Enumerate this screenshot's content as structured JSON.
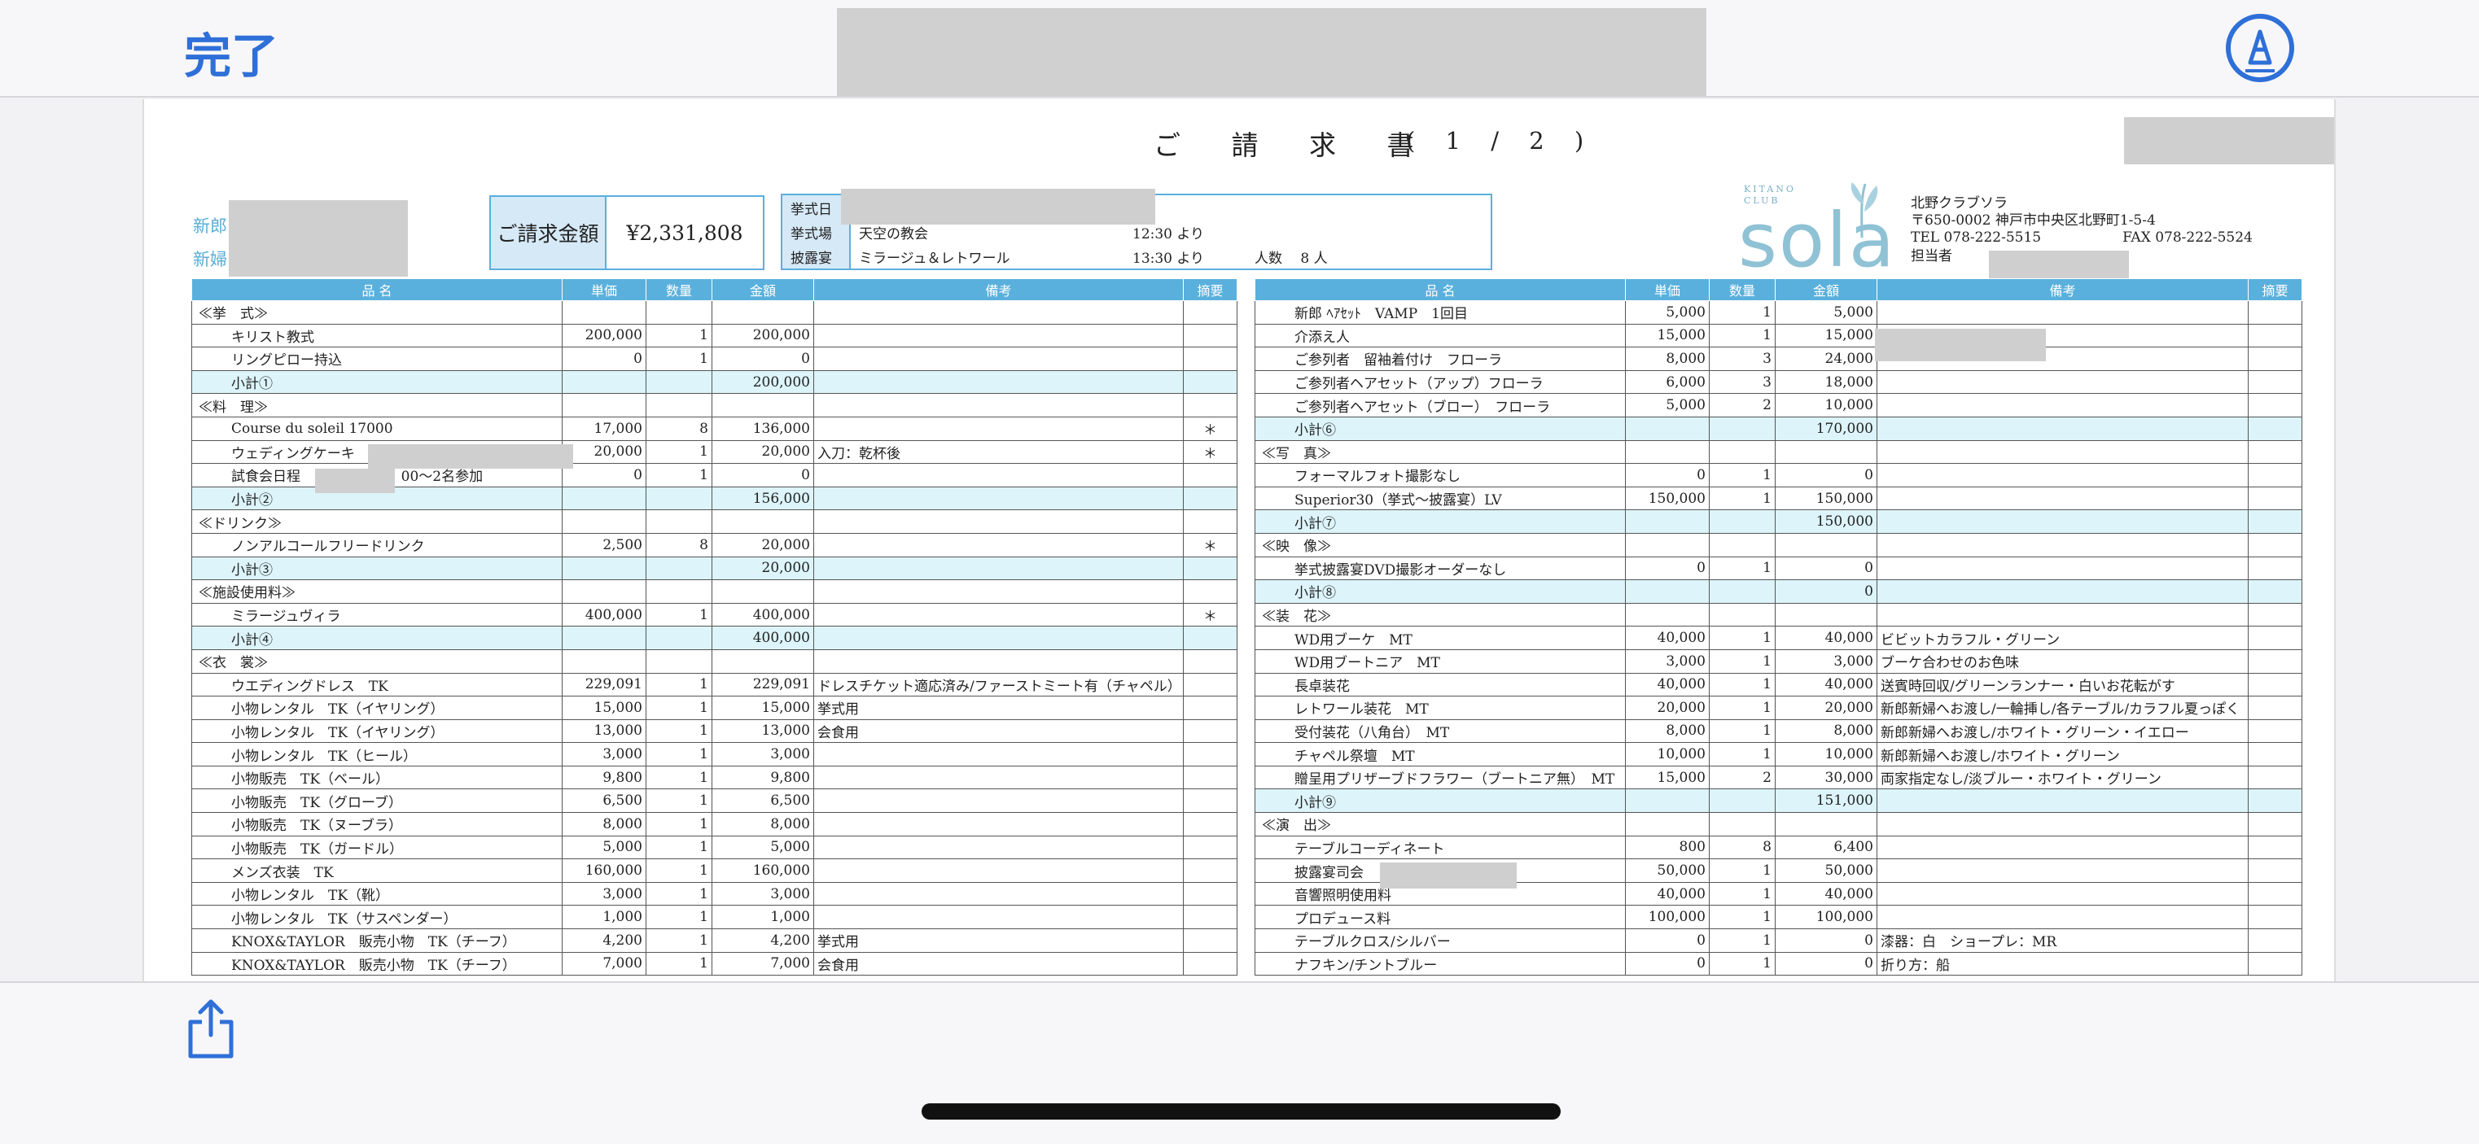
{
  "topbar": {
    "done_label": "完了",
    "markup_icon": "markup-pen-icon"
  },
  "document": {
    "title": "ご 請 求 書",
    "page": "( 1 / 2 )",
    "couple": {
      "groom_label": "新郎",
      "bride_label": "新婦"
    },
    "invoice": {
      "label": "ご請求金額",
      "amount": "¥2,331,808"
    },
    "ceremony": {
      "rows": [
        {
          "label": "挙式日",
          "value": "",
          "time": "",
          "extra": ""
        },
        {
          "label": "挙式場",
          "value": "天空の教会",
          "time": "12:30 より",
          "extra": ""
        },
        {
          "label": "披露宴",
          "value": "ミラージュ＆レトワール",
          "time": "13:30 より",
          "extra": "人数　 8 人"
        }
      ]
    },
    "logo": {
      "sub": "KITANO\nCLUB",
      "text": "sola"
    },
    "company": {
      "name": "北野クラブソラ",
      "address": "〒650-0002 神戸市中央区北野町1-5-4",
      "tel": "TEL 078-222-5515",
      "fax": "FAX 078-222-5524",
      "staff_label": "担当者"
    },
    "headers": [
      "品 名",
      "単価",
      "数量",
      "金額",
      "備考",
      "摘要"
    ],
    "left_rows": [
      {
        "t": "cat",
        "name": "≪挙　式≫"
      },
      {
        "t": "item",
        "name": "キリスト教式",
        "price": "200,000",
        "qty": "1",
        "amount": "200,000",
        "note": "",
        "mark": ""
      },
      {
        "t": "item",
        "name": "リングピロー持込",
        "price": "0",
        "qty": "1",
        "amount": "0",
        "note": "",
        "mark": ""
      },
      {
        "t": "sub",
        "name": "小計①",
        "amount": "200,000"
      },
      {
        "t": "cat",
        "name": "≪料　理≫"
      },
      {
        "t": "item",
        "name": "Course du soleil 17000",
        "price": "17,000",
        "qty": "8",
        "amount": "136,000",
        "note": "",
        "mark": "＊"
      },
      {
        "t": "item",
        "name": "ウェディングケーキ",
        "price": "20,000",
        "qty": "1",
        "amount": "20,000",
        "note": "入刀：乾杯後",
        "mark": "＊"
      },
      {
        "t": "item",
        "name": "試食会日程　　　　　18：00〜2名参加",
        "price": "0",
        "qty": "1",
        "amount": "0",
        "note": "",
        "mark": ""
      },
      {
        "t": "sub",
        "name": "小計②",
        "amount": "156,000"
      },
      {
        "t": "cat",
        "name": "≪ドリンク≫"
      },
      {
        "t": "item",
        "name": "ノンアルコールフリードリンク",
        "price": "2,500",
        "qty": "8",
        "amount": "20,000",
        "note": "",
        "mark": "＊"
      },
      {
        "t": "sub",
        "name": "小計③",
        "amount": "20,000"
      },
      {
        "t": "cat",
        "name": "≪施設使用料≫"
      },
      {
        "t": "item",
        "name": "ミラージュヴィラ",
        "price": "400,000",
        "qty": "1",
        "amount": "400,000",
        "note": "",
        "mark": "＊"
      },
      {
        "t": "sub",
        "name": "小計④",
        "amount": "400,000"
      },
      {
        "t": "cat",
        "name": "≪衣　裳≫"
      },
      {
        "t": "item",
        "name": "ウエディングドレス　TK",
        "price": "229,091",
        "qty": "1",
        "amount": "229,091",
        "note": "ドレスチケット適応済み/ファーストミート有（チャペル）",
        "mark": ""
      },
      {
        "t": "item",
        "name": "小物レンタル　TK（イヤリング）",
        "price": "15,000",
        "qty": "1",
        "amount": "15,000",
        "note": "挙式用",
        "mark": ""
      },
      {
        "t": "item",
        "name": "小物レンタル　TK（イヤリング）",
        "price": "13,000",
        "qty": "1",
        "amount": "13,000",
        "note": "会食用",
        "mark": ""
      },
      {
        "t": "item",
        "name": "小物レンタル　TK（ヒール）",
        "price": "3,000",
        "qty": "1",
        "amount": "3,000",
        "note": "",
        "mark": ""
      },
      {
        "t": "item",
        "name": "小物販売　TK（ベール）",
        "price": "9,800",
        "qty": "1",
        "amount": "9,800",
        "note": "",
        "mark": ""
      },
      {
        "t": "item",
        "name": "小物販売　TK（グローブ）",
        "price": "6,500",
        "qty": "1",
        "amount": "6,500",
        "note": "",
        "mark": ""
      },
      {
        "t": "item",
        "name": "小物販売　TK（ヌーブラ）",
        "price": "8,000",
        "qty": "1",
        "amount": "8,000",
        "note": "",
        "mark": ""
      },
      {
        "t": "item",
        "name": "小物販売　TK（ガードル）",
        "price": "5,000",
        "qty": "1",
        "amount": "5,000",
        "note": "",
        "mark": ""
      },
      {
        "t": "item",
        "name": "メンズ衣装　TK",
        "price": "160,000",
        "qty": "1",
        "amount": "160,000",
        "note": "",
        "mark": ""
      },
      {
        "t": "item",
        "name": "小物レンタル　TK（靴）",
        "price": "3,000",
        "qty": "1",
        "amount": "3,000",
        "note": "",
        "mark": ""
      },
      {
        "t": "item",
        "name": "小物レンタル　TK（サスペンダー）",
        "price": "1,000",
        "qty": "1",
        "amount": "1,000",
        "note": "",
        "mark": ""
      },
      {
        "t": "item",
        "name": "KNOX&TAYLOR　販売小物　TK（チーフ）",
        "price": "4,200",
        "qty": "1",
        "amount": "4,200",
        "note": "挙式用",
        "mark": ""
      },
      {
        "t": "item",
        "name": "KNOX&TAYLOR　販売小物　TK（チーフ）",
        "price": "7,000",
        "qty": "1",
        "amount": "7,000",
        "note": "会食用",
        "mark": ""
      }
    ],
    "right_rows": [
      {
        "t": "item",
        "name": "新郎 ﾍｱｾｯﾄ　VAMP　1回目",
        "price": "5,000",
        "qty": "1",
        "amount": "5,000",
        "note": "",
        "mark": ""
      },
      {
        "t": "item",
        "name": "介添え人",
        "price": "15,000",
        "qty": "1",
        "amount": "15,000",
        "note": "",
        "mark": ""
      },
      {
        "t": "item",
        "name": "ご参列者　留袖着付け　フローラ",
        "price": "8,000",
        "qty": "3",
        "amount": "24,000",
        "note": "",
        "mark": ""
      },
      {
        "t": "item",
        "name": "ご参列者ヘアセット（アップ）フローラ",
        "price": "6,000",
        "qty": "3",
        "amount": "18,000",
        "note": "",
        "mark": ""
      },
      {
        "t": "item",
        "name": "ご参列者ヘアセット（ブロー）　フローラ",
        "price": "5,000",
        "qty": "2",
        "amount": "10,000",
        "note": "",
        "mark": ""
      },
      {
        "t": "sub",
        "name": "小計⑥",
        "amount": "170,000"
      },
      {
        "t": "cat",
        "name": "≪写　真≫"
      },
      {
        "t": "item",
        "name": "フォーマルフォト撮影なし",
        "price": "0",
        "qty": "1",
        "amount": "0",
        "note": "",
        "mark": ""
      },
      {
        "t": "item",
        "name": "Superior30（挙式〜披露宴）LV",
        "price": "150,000",
        "qty": "1",
        "amount": "150,000",
        "note": "",
        "mark": ""
      },
      {
        "t": "sub",
        "name": "小計⑦",
        "amount": "150,000"
      },
      {
        "t": "cat",
        "name": "≪映　像≫"
      },
      {
        "t": "item",
        "name": "挙式披露宴DVD撮影オーダーなし",
        "price": "0",
        "qty": "1",
        "amount": "0",
        "note": "",
        "mark": ""
      },
      {
        "t": "sub",
        "name": "小計⑧",
        "amount": "0"
      },
      {
        "t": "cat",
        "name": "≪装　花≫"
      },
      {
        "t": "item",
        "name": "WD用ブーケ　MT",
        "price": "40,000",
        "qty": "1",
        "amount": "40,000",
        "note": "ビビットカラフル・グリーン",
        "mark": ""
      },
      {
        "t": "item",
        "name": "WD用ブートニア　MT",
        "price": "3,000",
        "qty": "1",
        "amount": "3,000",
        "note": "ブーケ合わせのお色味",
        "mark": ""
      },
      {
        "t": "item",
        "name": "長卓装花",
        "price": "40,000",
        "qty": "1",
        "amount": "40,000",
        "note": "送賓時回収/グリーンランナー・白いお花転がす",
        "mark": ""
      },
      {
        "t": "item",
        "name": "レトワール装花　MT",
        "price": "20,000",
        "qty": "1",
        "amount": "20,000",
        "note": "新郎新婦へお渡し/一輪挿し/各テーブル/カラフル夏っぽく",
        "mark": ""
      },
      {
        "t": "item",
        "name": "受付装花（八角台）　MT",
        "price": "8,000",
        "qty": "1",
        "amount": "8,000",
        "note": "新郎新婦へお渡し/ホワイト・グリーン・イエロー",
        "mark": ""
      },
      {
        "t": "item",
        "name": "チャペル祭壇　MT",
        "price": "10,000",
        "qty": "1",
        "amount": "10,000",
        "note": "新郎新婦へお渡し/ホワイト・グリーン",
        "mark": ""
      },
      {
        "t": "item",
        "name": "贈呈用プリザーブドフラワー（ブートニア無）　MT",
        "price": "15,000",
        "qty": "2",
        "amount": "30,000",
        "note": "両家指定なし/淡ブルー・ホワイト・グリーン",
        "mark": ""
      },
      {
        "t": "sub",
        "name": "小計⑨",
        "amount": "151,000"
      },
      {
        "t": "cat",
        "name": "≪演　出≫"
      },
      {
        "t": "item",
        "name": "テーブルコーディネート",
        "price": "800",
        "qty": "8",
        "amount": "6,400",
        "note": "",
        "mark": ""
      },
      {
        "t": "item",
        "name": "披露宴司会",
        "price": "50,000",
        "qty": "1",
        "amount": "50,000",
        "note": "",
        "mark": ""
      },
      {
        "t": "item",
        "name": "音響照明使用料",
        "price": "40,000",
        "qty": "1",
        "amount": "40,000",
        "note": "",
        "mark": ""
      },
      {
        "t": "item",
        "name": "プロデュース料",
        "price": "100,000",
        "qty": "1",
        "amount": "100,000",
        "note": "",
        "mark": ""
      },
      {
        "t": "item",
        "name": "テーブルクロス/シルバー",
        "price": "0",
        "qty": "1",
        "amount": "0",
        "note": "漆器：白　ショープレ：MR",
        "mark": ""
      },
      {
        "t": "item",
        "name": "ナフキン/チントブルー",
        "price": "0",
        "qty": "1",
        "amount": "0",
        "note": "折り方：船",
        "mark": ""
      }
    ]
  },
  "bottombar": {
    "share_icon": "share-icon"
  }
}
